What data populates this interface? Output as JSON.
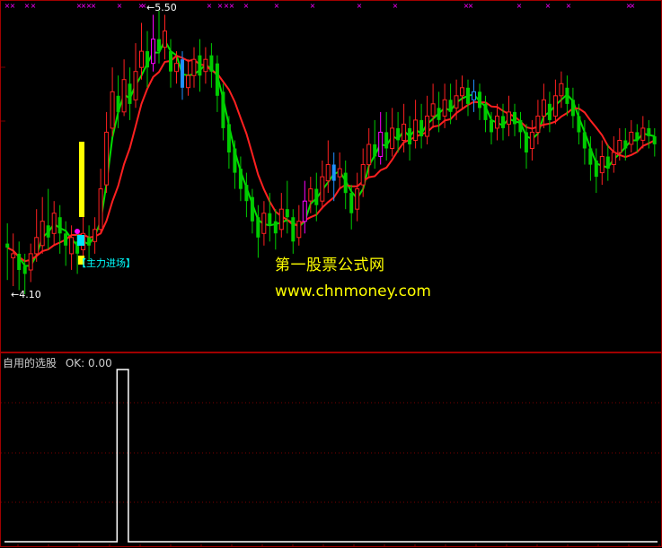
{
  "chart_data": [
    {
      "type": "candlestick",
      "annotations": {
        "high_marker": "5.50",
        "low_marker": "4.10",
        "signal_label": "【主力进场】"
      },
      "ylim": [
        4.1,
        5.5
      ],
      "candles": [
        [
          4.35,
          4.33,
          4.45,
          4.17
        ],
        [
          4.28,
          4.3,
          4.4,
          4.14
        ],
        [
          4.3,
          4.22,
          4.36,
          4.12
        ],
        [
          4.24,
          4.2,
          4.3,
          4.1
        ],
        [
          4.22,
          4.3,
          4.35,
          4.16
        ],
        [
          4.3,
          4.38,
          4.52,
          4.26
        ],
        [
          4.34,
          4.46,
          4.58,
          4.3
        ],
        [
          4.44,
          4.38,
          4.62,
          4.32
        ],
        [
          4.4,
          4.5,
          4.56,
          4.34
        ],
        [
          4.48,
          4.4,
          4.54,
          4.3
        ],
        [
          4.4,
          4.34,
          4.46,
          4.24
        ],
        [
          4.3,
          4.38,
          4.44,
          4.22
        ],
        [
          4.36,
          4.3,
          4.42,
          4.2
        ],
        [
          4.32,
          4.4,
          4.48,
          4.26
        ],
        [
          4.38,
          4.34,
          4.44,
          4.26
        ],
        [
          4.36,
          4.42,
          4.48,
          4.3
        ],
        [
          4.42,
          4.62,
          4.72,
          4.4
        ],
        [
          4.64,
          4.9,
          5.0,
          4.6
        ],
        [
          4.92,
          5.1,
          5.22,
          4.88
        ],
        [
          5.08,
          5.0,
          5.18,
          4.92
        ],
        [
          5.0,
          5.16,
          5.26,
          4.98
        ],
        [
          5.14,
          5.04,
          5.22,
          4.96
        ],
        [
          5.06,
          5.2,
          5.34,
          5.02
        ],
        [
          5.22,
          5.3,
          5.44,
          5.16
        ],
        [
          5.3,
          5.22,
          5.4,
          5.12
        ],
        [
          5.24,
          5.36,
          5.48,
          5.2
        ],
        [
          5.36,
          5.3,
          5.5,
          5.24
        ],
        [
          5.32,
          5.4,
          5.48,
          5.26
        ],
        [
          5.3,
          5.2,
          5.36,
          5.12
        ],
        [
          5.2,
          5.24,
          5.3,
          5.14
        ],
        [
          5.26,
          5.12,
          5.3,
          5.06
        ],
        [
          5.12,
          5.18,
          5.26,
          5.08
        ],
        [
          5.18,
          5.26,
          5.32,
          5.12
        ],
        [
          5.28,
          5.18,
          5.36,
          5.1
        ],
        [
          5.2,
          5.26,
          5.32,
          5.14
        ],
        [
          5.28,
          5.2,
          5.34,
          5.12
        ],
        [
          5.24,
          5.08,
          5.28,
          5.0
        ],
        [
          5.1,
          4.92,
          5.14,
          4.86
        ],
        [
          4.94,
          4.8,
          4.98,
          4.72
        ],
        [
          4.82,
          4.7,
          4.86,
          4.62
        ],
        [
          4.72,
          4.62,
          4.78,
          4.56
        ],
        [
          4.64,
          4.56,
          4.7,
          4.48
        ],
        [
          4.58,
          4.46,
          4.62,
          4.4
        ],
        [
          4.48,
          4.38,
          4.54,
          4.28
        ],
        [
          4.4,
          4.5,
          4.56,
          4.34
        ],
        [
          4.5,
          4.44,
          4.6,
          4.36
        ],
        [
          4.46,
          4.4,
          4.52,
          4.32
        ],
        [
          4.42,
          4.52,
          4.6,
          4.38
        ],
        [
          4.52,
          4.48,
          4.66,
          4.4
        ],
        [
          4.48,
          4.36,
          4.52,
          4.3
        ],
        [
          4.38,
          4.46,
          4.54,
          4.34
        ],
        [
          4.46,
          4.56,
          4.66,
          4.4
        ],
        [
          4.56,
          4.62,
          4.68,
          4.5
        ],
        [
          4.62,
          4.54,
          4.7,
          4.46
        ],
        [
          4.56,
          4.68,
          4.76,
          4.52
        ],
        [
          4.66,
          4.74,
          4.86,
          4.6
        ],
        [
          4.74,
          4.66,
          4.8,
          4.56
        ],
        [
          4.68,
          4.72,
          4.8,
          4.62
        ],
        [
          4.7,
          4.6,
          4.76,
          4.52
        ],
        [
          4.6,
          4.5,
          4.64,
          4.42
        ],
        [
          4.52,
          4.62,
          4.7,
          4.46
        ],
        [
          4.64,
          4.74,
          4.82,
          4.58
        ],
        [
          4.74,
          4.84,
          4.92,
          4.68
        ],
        [
          4.84,
          4.78,
          4.96,
          4.72
        ],
        [
          4.78,
          4.9,
          5.0,
          4.74
        ],
        [
          4.9,
          4.82,
          5.0,
          4.76
        ],
        [
          4.82,
          4.92,
          5.02,
          4.78
        ],
        [
          4.92,
          4.86,
          5.0,
          4.8
        ],
        [
          4.86,
          4.94,
          5.04,
          4.8
        ],
        [
          4.92,
          4.84,
          4.98,
          4.76
        ],
        [
          4.86,
          4.96,
          5.06,
          4.82
        ],
        [
          4.96,
          4.88,
          5.04,
          4.82
        ],
        [
          4.88,
          4.98,
          5.08,
          4.84
        ],
        [
          4.98,
          5.04,
          5.14,
          4.92
        ],
        [
          5.02,
          4.96,
          5.1,
          4.9
        ],
        [
          4.98,
          5.06,
          5.14,
          4.92
        ],
        [
          5.06,
          5.0,
          5.14,
          4.94
        ],
        [
          5.02,
          5.08,
          5.16,
          4.96
        ],
        [
          5.08,
          5.12,
          5.18,
          5.02
        ],
        [
          5.12,
          5.04,
          5.16,
          4.98
        ],
        [
          5.06,
          5.1,
          5.16,
          5.0
        ],
        [
          5.1,
          5.02,
          5.14,
          4.96
        ],
        [
          5.04,
          4.96,
          5.08,
          4.9
        ],
        [
          4.96,
          4.9,
          5.0,
          4.84
        ],
        [
          4.92,
          4.98,
          5.04,
          4.86
        ],
        [
          4.98,
          4.92,
          5.04,
          4.86
        ],
        [
          4.94,
          5.0,
          5.08,
          4.88
        ],
        [
          5.0,
          4.94,
          5.04,
          4.88
        ],
        [
          4.96,
          4.9,
          5.0,
          4.82
        ],
        [
          4.9,
          4.8,
          4.94,
          4.72
        ],
        [
          4.82,
          4.9,
          4.96,
          4.76
        ],
        [
          4.9,
          4.98,
          5.06,
          4.84
        ],
        [
          4.98,
          5.06,
          5.14,
          4.92
        ],
        [
          5.04,
          4.96,
          5.1,
          4.9
        ],
        [
          4.98,
          5.08,
          5.16,
          4.94
        ],
        [
          5.08,
          5.14,
          5.2,
          5.02
        ],
        [
          5.12,
          5.04,
          5.18,
          4.98
        ],
        [
          5.06,
          4.98,
          5.12,
          4.92
        ],
        [
          4.98,
          4.9,
          5.04,
          4.84
        ],
        [
          4.9,
          4.82,
          4.96,
          4.74
        ],
        [
          4.82,
          4.74,
          4.88,
          4.66
        ],
        [
          4.76,
          4.68,
          4.82,
          4.6
        ],
        [
          4.7,
          4.78,
          4.86,
          4.64
        ],
        [
          4.78,
          4.72,
          4.84,
          4.66
        ],
        [
          4.74,
          4.8,
          4.88,
          4.7
        ],
        [
          4.8,
          4.86,
          4.92,
          4.76
        ],
        [
          4.86,
          4.82,
          4.92,
          4.76
        ],
        [
          4.84,
          4.9,
          4.96,
          4.8
        ],
        [
          4.9,
          4.86,
          4.94,
          4.8
        ],
        [
          4.86,
          4.92,
          4.98,
          4.82
        ],
        [
          4.92,
          4.88,
          4.96,
          4.82
        ],
        [
          4.88,
          4.84,
          4.92,
          4.78
        ]
      ]
    },
    {
      "type": "line",
      "title": "自用的选股",
      "legend": "OK: 0.00",
      "series": [
        {
          "name": "OK",
          "values": [
            0,
            0,
            0,
            0,
            0,
            0,
            0,
            0,
            0,
            0,
            0,
            0,
            0,
            0,
            0,
            0,
            0,
            0,
            0,
            0,
            1,
            1,
            0,
            0,
            0,
            0,
            0,
            0,
            0,
            0,
            0,
            0,
            0,
            0,
            0,
            0,
            0,
            0,
            0,
            0,
            0,
            0,
            0,
            0,
            0,
            0,
            0,
            0,
            0,
            0,
            0,
            0,
            0,
            0,
            0,
            0,
            0,
            0,
            0,
            0,
            0,
            0,
            0,
            0,
            0,
            0,
            0,
            0,
            0,
            0,
            0,
            0,
            0,
            0,
            0,
            0,
            0,
            0,
            0,
            0,
            0,
            0,
            0,
            0,
            0,
            0,
            0,
            0,
            0,
            0,
            0,
            0,
            0,
            0,
            0,
            0,
            0,
            0,
            0,
            0,
            0,
            0,
            0,
            0,
            0,
            0,
            0,
            0,
            0,
            0,
            0,
            0,
            0,
            0,
            0,
            0
          ]
        }
      ]
    }
  ],
  "watermark": {
    "line1": "第一股票公式网",
    "line2": "www.chnmoney.com"
  },
  "colors": {
    "up": "#ff2020",
    "down": "#00cc00",
    "ma_fast": "#ff2020",
    "ma_slow": "#00dd00",
    "signal_bar": "#ffff00",
    "panel_border": "#a00000",
    "grid": "#7a0000",
    "highlight_up": "#ff00ff",
    "highlight_down": "#2090ff"
  }
}
